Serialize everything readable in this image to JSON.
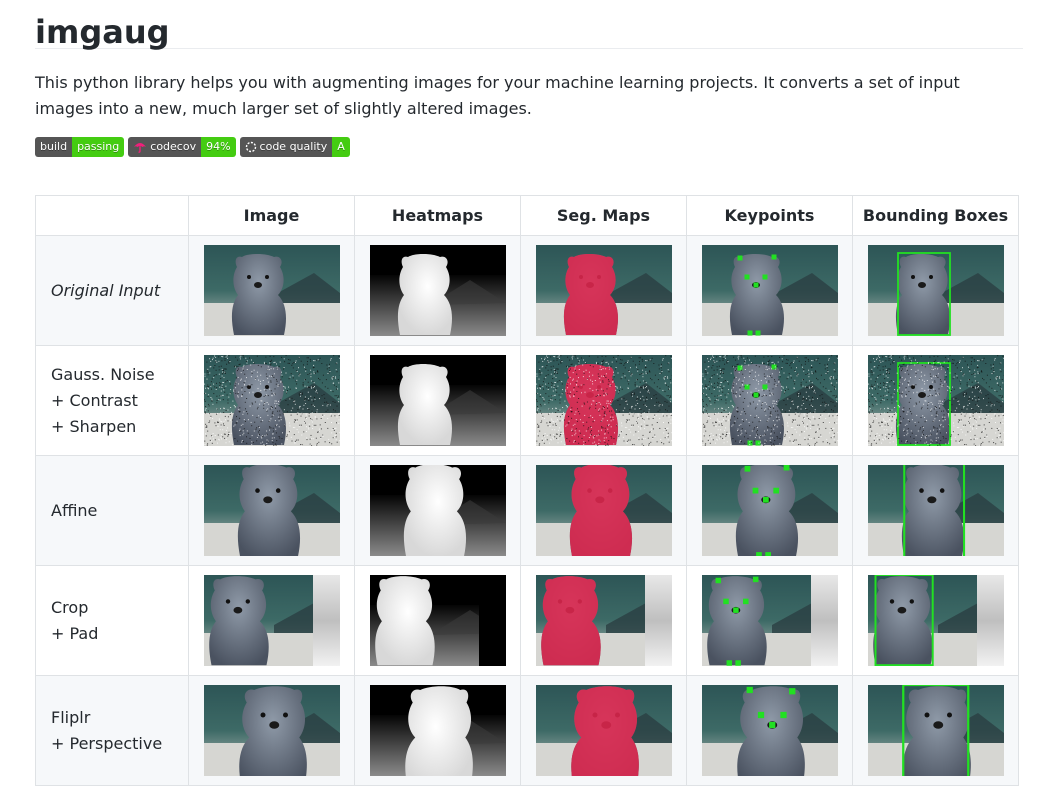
{
  "title": "imgaug",
  "description": "This python library helps you with augmenting images for your machine learning projects. It converts a set of input images into a new, much larger set of slightly altered images.",
  "badges": [
    {
      "left": "build",
      "right": "passing",
      "icon": "",
      "color": "#4c1"
    },
    {
      "left": "codecov",
      "right": "94%",
      "icon": "umbrella-icon",
      "color": "#4c1"
    },
    {
      "left": "code quality",
      "right": "A",
      "icon": "dashed-circle-icon",
      "color": "#44cc11"
    }
  ],
  "table": {
    "headers": [
      "",
      "Image",
      "Heatmaps",
      "Seg. Maps",
      "Keypoints",
      "Bounding Boxes"
    ],
    "rows": [
      {
        "label_lines": [
          "Original Input"
        ],
        "italic": true,
        "variant": "original"
      },
      {
        "label_lines": [
          "Gauss. Noise",
          "+ Contrast",
          "+ Sharpen"
        ],
        "italic": false,
        "variant": "noise"
      },
      {
        "label_lines": [
          "Affine"
        ],
        "italic": false,
        "variant": "affine"
      },
      {
        "label_lines": [
          "Crop",
          "+ Pad"
        ],
        "italic": false,
        "variant": "crop"
      },
      {
        "label_lines": [
          "Fliplr",
          "+ Perspective"
        ],
        "italic": false,
        "variant": "flip"
      }
    ]
  },
  "colors": {
    "segmentation": "#e0274f",
    "keypoint": "#22e022",
    "bbox": "#22e022"
  }
}
